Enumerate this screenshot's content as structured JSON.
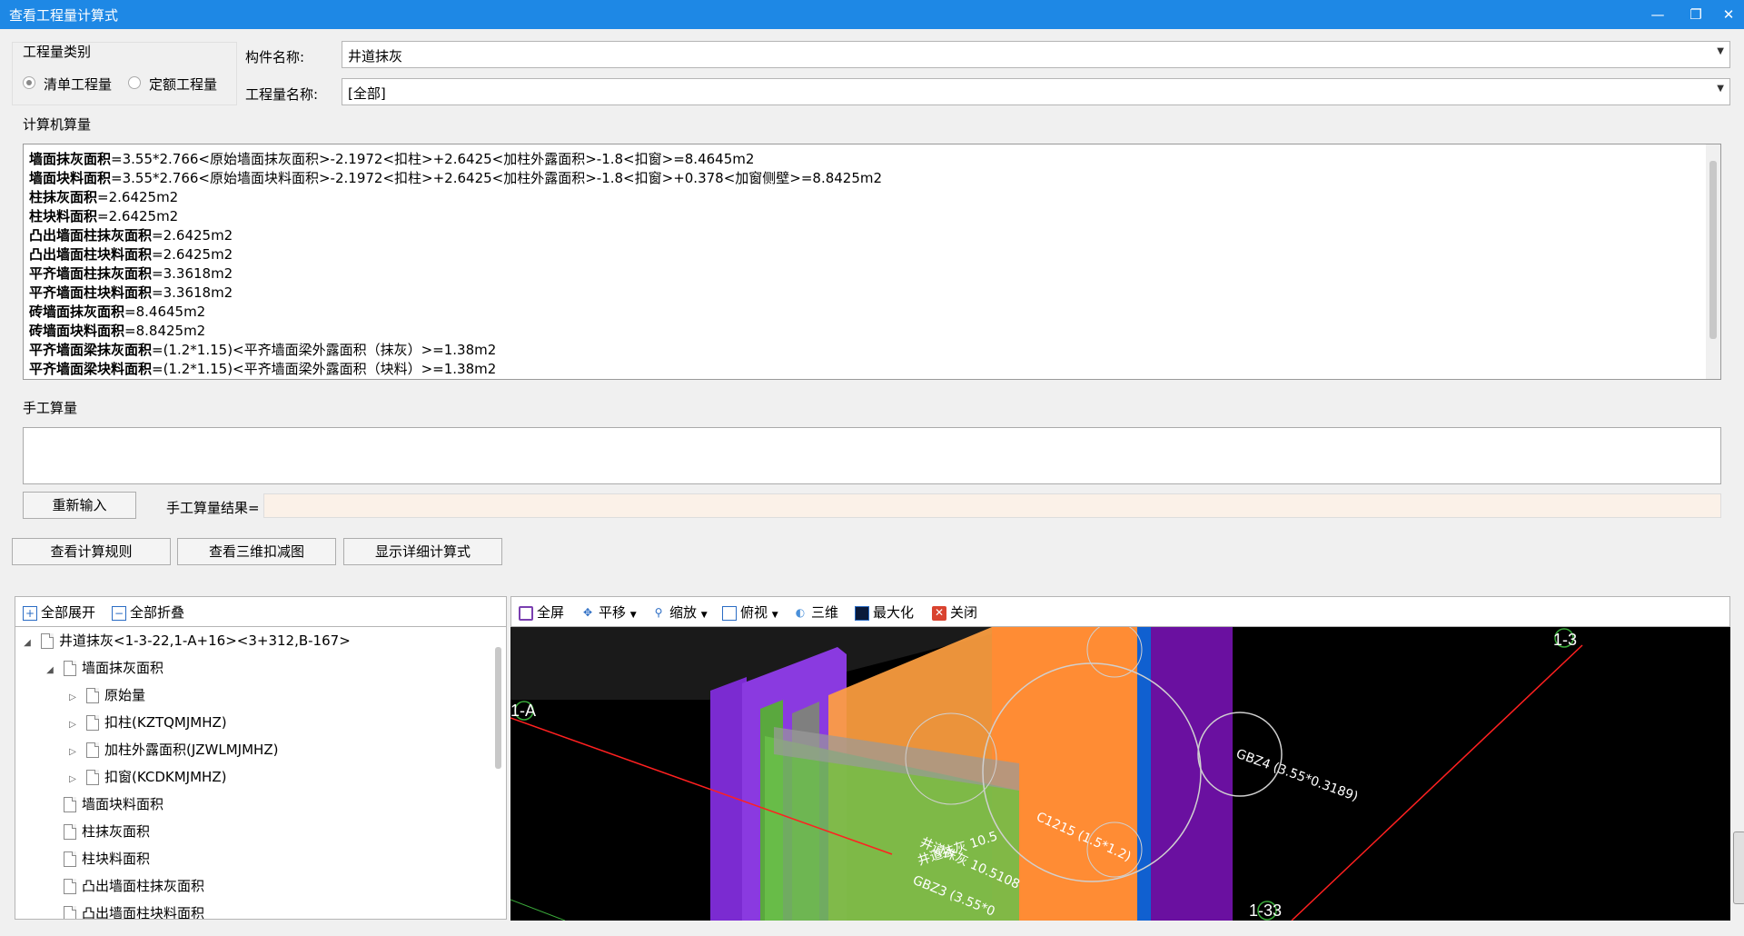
{
  "window": {
    "title": "查看工程量计算式",
    "min_icon": "minimize-icon",
    "restore_icon": "restore-icon",
    "close_icon": "close-icon"
  },
  "category": {
    "legend": "工程量类别",
    "options": [
      {
        "label": "清单工程量",
        "selected": true
      },
      {
        "label": "定额工程量",
        "selected": false
      }
    ]
  },
  "component": {
    "label": "构件名称:",
    "value": "井道抹灰"
  },
  "quantity": {
    "label": "工程量名称:",
    "value": "[全部]"
  },
  "computer": {
    "label": "计算机算量",
    "lines": [
      {
        "name": "墙面抹灰面积",
        "expr": "=3.55*2.766<原始墙面抹灰面积>-2.1972<扣柱>+2.6425<加柱外露面积>-1.8<扣窗>=8.4645m2"
      },
      {
        "name": "墙面块料面积",
        "expr": "=3.55*2.766<原始墙面块料面积>-2.1972<扣柱>+2.6425<加柱外露面积>-1.8<扣窗>+0.378<加窗侧壁>=8.8425m2"
      },
      {
        "name": "柱抹灰面积",
        "expr": "=2.6425m2"
      },
      {
        "name": "柱块料面积",
        "expr": "=2.6425m2"
      },
      {
        "name": "凸出墙面柱抹灰面积",
        "expr": "=2.6425m2"
      },
      {
        "name": "凸出墙面柱块料面积",
        "expr": "=2.6425m2"
      },
      {
        "name": "平齐墙面柱抹灰面积",
        "expr": "=3.3618m2"
      },
      {
        "name": "平齐墙面柱块料面积",
        "expr": "=3.3618m2"
      },
      {
        "name": "砖墙面抹灰面积",
        "expr": "=8.4645m2"
      },
      {
        "name": "砖墙面块料面积",
        "expr": "=8.8425m2"
      },
      {
        "name": "平齐墙面梁抹灰面积",
        "expr": "=(1.2*1.15)<平齐墙面梁外露面积（抹灰）>=1.38m2"
      },
      {
        "name": "平齐墙面梁块料面积",
        "expr": "=(1.2*1.15)<平齐墙面梁外露面积（块料）>=1.38m2"
      }
    ]
  },
  "manual": {
    "label": "手工算量",
    "reinput": "重新输入",
    "result_label": "手工算量结果="
  },
  "actions": {
    "rules": "查看计算规则",
    "view3d": "查看三维扣减图",
    "detail": "显示详细计算式"
  },
  "tree_toolbar": {
    "expand": "全部展开",
    "collapse": "全部折叠"
  },
  "tree": [
    {
      "label": "井道抹灰<1-3-22,1-A+16><3+312,B-167>",
      "level": 0,
      "exp": "◢"
    },
    {
      "label": "墙面抹灰面积",
      "level": 1,
      "exp": "◢"
    },
    {
      "label": "原始量",
      "level": 2,
      "exp": "▷"
    },
    {
      "label": "扣柱(KZTQMJMHZ)",
      "level": 2,
      "exp": "▷"
    },
    {
      "label": "加柱外露面积(JZWLMJMHZ)",
      "level": 2,
      "exp": "▷"
    },
    {
      "label": "扣窗(KCDKMJMHZ)",
      "level": 2,
      "exp": "▷"
    },
    {
      "label": "墙面块料面积",
      "level": 1,
      "exp": ""
    },
    {
      "label": "柱抹灰面积",
      "level": 1,
      "exp": ""
    },
    {
      "label": "柱块料面积",
      "level": 1,
      "exp": ""
    },
    {
      "label": "凸出墙面柱抹灰面积",
      "level": 1,
      "exp": ""
    },
    {
      "label": "凸出墙面柱块料面积",
      "level": 1,
      "exp": ""
    }
  ],
  "view_toolbar": {
    "fullscreen": "全屏",
    "pan": "平移",
    "zoom": "缩放",
    "topview": "俯视",
    "threed": "三维",
    "maximize": "最大化",
    "close": "关闭"
  },
  "scene": {
    "axis_13": "1-3",
    "axis_1A": "1-A",
    "axis_133": "1-33",
    "label_gbz4": "GBZ4 (3.55*0.3189)",
    "label_c1215": "C1215 (1.5*1.2)",
    "label_wall": "井道抹灰 10.5108",
    "label_gbz3": "GBZ3 (3.55*0",
    "label_overlap": "井道抹灰 10.5"
  }
}
